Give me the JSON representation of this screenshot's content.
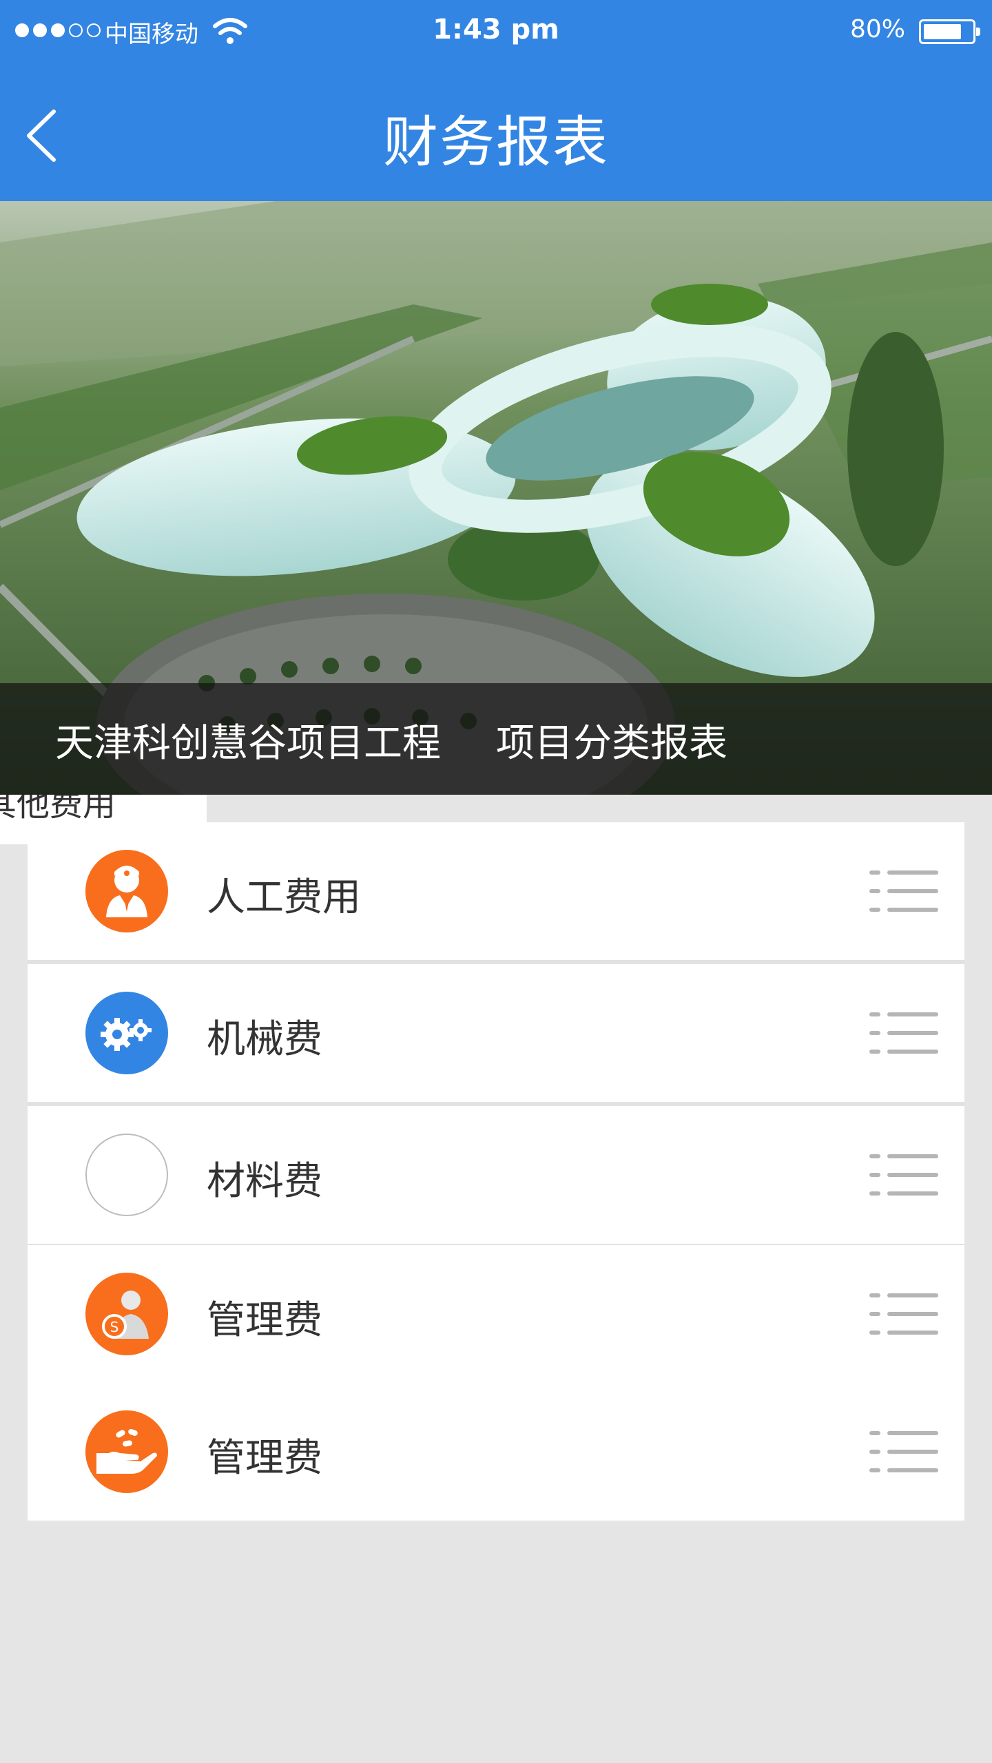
{
  "status_bar": {
    "carrier": "中国移动",
    "time": "1:43 pm",
    "battery_percent": "80%",
    "battery_level": 0.8
  },
  "nav": {
    "title": "财务报表",
    "back_icon": "chevron-left-icon"
  },
  "banner": {
    "project_name": "天津科创慧谷项目工程",
    "report_type": "项目分类报表"
  },
  "tag": {
    "label": "其他费用"
  },
  "items": [
    {
      "label": "人工费用",
      "icon": "worker-icon",
      "icon_color": "#f86e1c"
    },
    {
      "label": "机械费",
      "icon": "gears-icon",
      "icon_color": "#3385e3"
    },
    {
      "label": "材料费",
      "icon": "empty-circle-icon",
      "icon_color": "#ffffff"
    },
    {
      "label": "管理费",
      "icon": "manager-money-icon",
      "icon_color": "#f86e1c"
    },
    {
      "label": "管理费",
      "icon": "hand-pills-icon",
      "icon_color": "#f86e1c"
    }
  ],
  "colors": {
    "primary": "#3385e3",
    "accent": "#f86e1c",
    "background": "#e5e5e5"
  }
}
